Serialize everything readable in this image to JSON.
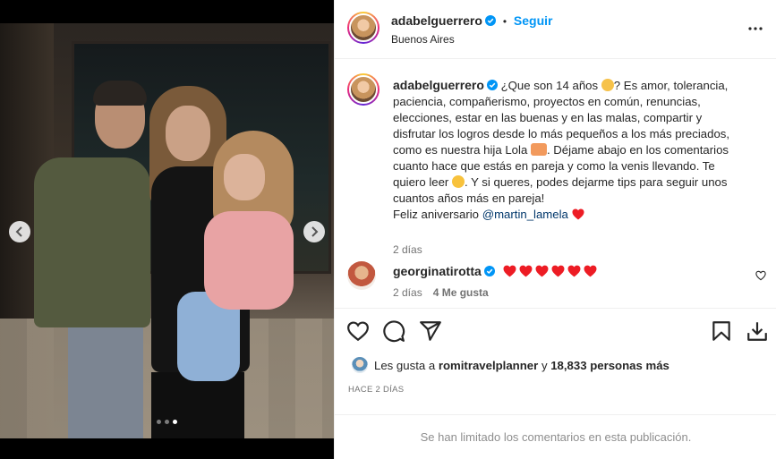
{
  "post": {
    "username": "adabelguerrero",
    "follow_label": "Seguir",
    "separator": "•",
    "location": "Buenos Aires",
    "carousel": {
      "slide_count": 3,
      "active_index": 2
    }
  },
  "caption": {
    "username": "adabelguerrero",
    "lines": [
      "¿Que son 14 años",
      "? Es amor, tolerancia,",
      "paciencia, compañerismo, proyectos en común, renuncias,",
      "elecciones, estar en las buenas y en las malas, compartir y",
      "disfrutar los logros desde lo más pequeños a los más preciados,",
      "como es nuestra hija Lola",
      ". Déjame abajo en los comentarios",
      "cuanto hace que estás en pareja y como la venis llevando. Te",
      "quiero leer",
      ". Y si queres, podes dejarme tips para seguir unos",
      "cuantos años más en pareja!",
      "Feliz aniversario",
      "@martin_lamela"
    ],
    "time": "2 días"
  },
  "comment": {
    "username": "georginatirotta",
    "heart_count": 6,
    "time": "2 días",
    "likes": "4 Me gusta"
  },
  "likes": {
    "prefix": "Les gusta a",
    "user": "romitravelplanner",
    "middle": "y",
    "others": "18,833 personas más"
  },
  "posted_ago": "HACE 2 DÍAS",
  "footer_text": "Se han limitado los comentarios en esta publicación.",
  "colors": {
    "link": "#0095f6",
    "heart": "#ed4956",
    "verified": "#0095f6",
    "muted": "#737373"
  },
  "icons": [
    "verified-icon",
    "more-options-icon",
    "chevron-left-icon",
    "chevron-right-icon",
    "heart-icon",
    "comment-icon",
    "share-icon",
    "bookmark-icon",
    "download-icon"
  ]
}
